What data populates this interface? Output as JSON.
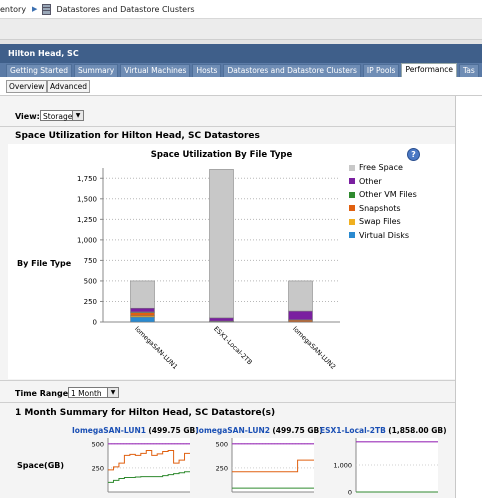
{
  "breadcrumb": {
    "inventory": "entory",
    "current": "Datastores and Datastore Clusters"
  },
  "header": {
    "title": "Hilton Head, SC"
  },
  "tabs": [
    {
      "label": "Getting Started"
    },
    {
      "label": "Summary"
    },
    {
      "label": "Virtual Machines"
    },
    {
      "label": "Hosts"
    },
    {
      "label": "Datastores and Datastore Clusters"
    },
    {
      "label": "IP Pools"
    },
    {
      "label": "Performance"
    },
    {
      "label": "Tas"
    }
  ],
  "subtabs": {
    "overview": "Overview",
    "advanced": "Advanced"
  },
  "view": {
    "label": "View:",
    "value": "Storage"
  },
  "section_title": "Space Utilization for Hilton Head, SC Datastores",
  "row_label": "By File Type",
  "time_range": {
    "label": "Time Range:",
    "value": "1 Month"
  },
  "summary_title": "1 Month Summary for Hilton Head, SC Datastore(s)",
  "space_label": "Space(GB)",
  "colors": {
    "free": "#c8c8c8",
    "other": "#7a1fa0",
    "other_vm": "#2f8a2f",
    "snapshots": "#e06010",
    "swap": "#f0b020",
    "vdisks": "#2a8ad0"
  },
  "chart_data": {
    "type": "bar",
    "title": "Space Utilization By File Type",
    "categories": [
      "IomegaSAN-LUN1",
      "ESX1-Local-2TB",
      "IomegaSAN-LUN2"
    ],
    "ylim": [
      0,
      1875
    ],
    "yticks": [
      "0",
      "250",
      "500",
      "750",
      "1,000",
      "1,250",
      "1,500",
      "1,750"
    ],
    "ytick_values": [
      0,
      250,
      500,
      750,
      1000,
      1250,
      1500,
      1750
    ],
    "series": [
      {
        "name": "Virtual Disks",
        "color": "#2a8ad0",
        "values": [
          60,
          4,
          0
        ]
      },
      {
        "name": "Swap Files",
        "color": "#f0b020",
        "values": [
          15,
          2,
          3
        ]
      },
      {
        "name": "Snapshots",
        "color": "#e06010",
        "values": [
          40,
          4,
          20
        ]
      },
      {
        "name": "Other VM Files",
        "color": "#2f8a2f",
        "values": [
          8,
          2,
          5
        ]
      },
      {
        "name": "Other",
        "color": "#7a1fa0",
        "values": [
          45,
          38,
          105
        ]
      },
      {
        "name": "Free Space",
        "color": "#c8c8c8",
        "values": [
          332,
          1808,
          367
        ]
      }
    ],
    "legend": [
      "Free Space",
      "Other",
      "Other VM Files",
      "Snapshots",
      "Swap Files",
      "Virtual Disks"
    ],
    "legend_position": "right"
  },
  "mini_charts": [
    {
      "name": "IomegaSAN-LUN1",
      "size": "(499.75 GB)",
      "yticks": [
        "500",
        "250"
      ],
      "ylim": [
        0,
        560
      ]
    },
    {
      "name": "IomegaSAN-LUN2",
      "size": "(499.75 GB)",
      "yticks": [
        "500",
        "250"
      ],
      "ylim": [
        0,
        560
      ]
    },
    {
      "name": "ESX1-Local-2TB",
      "size": "(1,858.00 GB)",
      "yticks": [
        "1,000",
        "0"
      ],
      "ylim": [
        0,
        2000
      ]
    }
  ],
  "mini_line_data": [
    {
      "capacity": 499.75,
      "lines": [
        {
          "color": "#e06010",
          "values": [
            230,
            260,
            300,
            380,
            390,
            380,
            400,
            430,
            380,
            395,
            420,
            430,
            300,
            330,
            400,
            400
          ]
        },
        {
          "color": "#2f8a2f",
          "values": [
            100,
            120,
            140,
            150,
            150,
            155,
            160,
            160,
            160,
            160,
            170,
            180,
            190,
            200,
            210,
            210
          ]
        }
      ]
    },
    {
      "capacity": 499.75,
      "lines": [
        {
          "color": "#e06010",
          "values": [
            210,
            210,
            210,
            210,
            210,
            210,
            210,
            210,
            210,
            210,
            210,
            210,
            330,
            330,
            330,
            330
          ]
        },
        {
          "color": "#2f8a2f",
          "values": [
            40,
            40,
            40,
            40,
            40,
            40,
            40,
            40,
            40,
            40,
            40,
            40,
            40,
            40,
            40,
            40
          ]
        }
      ]
    },
    {
      "capacity": 1858,
      "lines": [
        {
          "color": "#e06010",
          "values": [
            0,
            0,
            0,
            0,
            0,
            0,
            0,
            0,
            0,
            0,
            0,
            0,
            0,
            0,
            0,
            0
          ]
        },
        {
          "color": "#2f8a2f",
          "values": [
            0,
            0,
            0,
            0,
            0,
            0,
            0,
            0,
            0,
            0,
            0,
            0,
            0,
            0,
            0,
            0
          ]
        }
      ]
    }
  ]
}
